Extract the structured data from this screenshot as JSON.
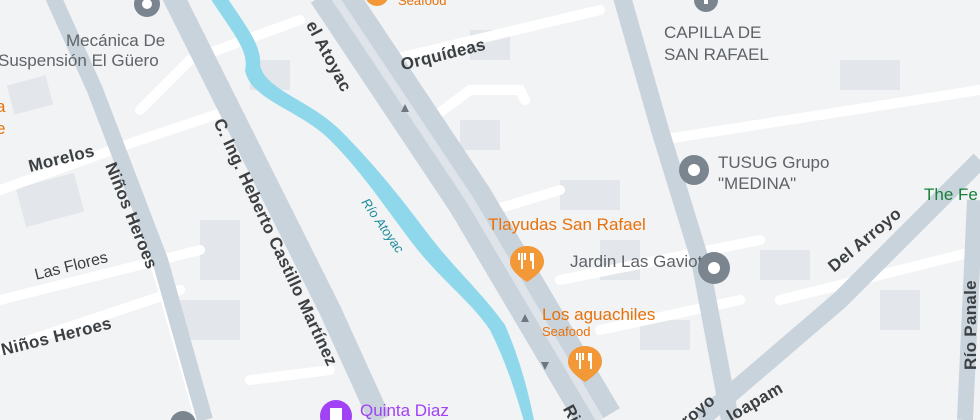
{
  "map": {
    "streets": {
      "atoyac_top": "el Atoyac",
      "orquideas": "Orquídeas",
      "morelos": "Morelos",
      "ninos_heroes_vertical": "Niños Heroes",
      "las_flores": "Las Flores",
      "ninos_heroes_horizontal": "Niños Heroes",
      "heberto": "C. Ing. Heberto Castillo Martínez",
      "del_arroyo": "Del Arroyo",
      "rio_panales": "Río Panale",
      "loapam": "loapam",
      "arroyo_bottom": "royo",
      "ri_bottom": "Ri"
    },
    "river": {
      "label": "Río Atoyac"
    },
    "places": {
      "mecanica_line1": "Mecánica De",
      "mecanica_line2": "Suspensión El Güero",
      "capilla_line1": "CAPILLA DE",
      "capilla_line2": "SAN RAFAEL",
      "tusug_line1": "TUSUG Grupo",
      "tusug_line2": "\"MEDINA\"",
      "jardin": "Jardin Las Gaviotas",
      "quinta": "Quinta Diaz",
      "the_fe": "The Fe"
    },
    "restaurants": {
      "seafood_top": "Seafood",
      "tlayudas": "Tlayudas San Rafael",
      "aguachiles": "Los aguachiles",
      "aguachiles_sub": "Seafood",
      "left_partial_1": "a",
      "left_partial_2": "e"
    },
    "colors": {
      "background": "#f1f3f4",
      "major_road": "#c9d3dc",
      "minor_road": "#ffffff",
      "river": "#8fd8ec",
      "block": "#e3e6ea",
      "food_pin": "#f29837",
      "poi_pin": "#7b8590",
      "worship_pin": "#a142f4"
    },
    "icons": [
      "restaurant-icon",
      "map-pin-icon",
      "worship-icon",
      "one-way-arrow-icon"
    ]
  }
}
